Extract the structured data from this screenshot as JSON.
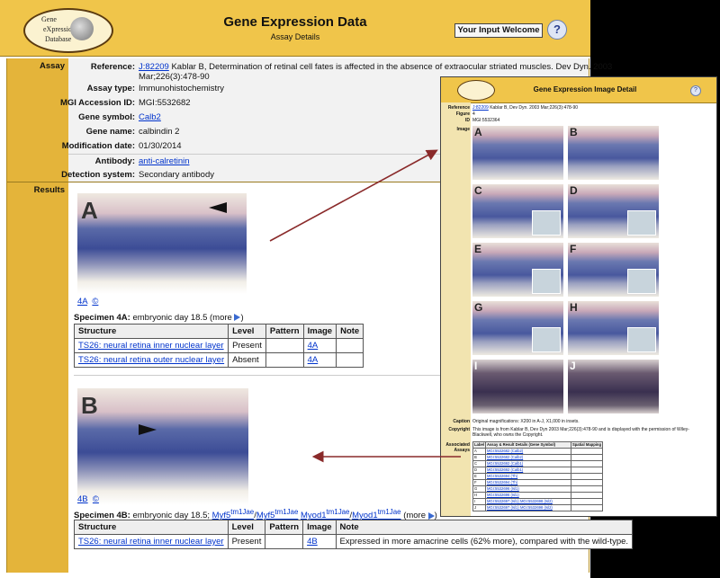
{
  "header": {
    "title": "Gene Expression Data",
    "subtitle": "Assay Details",
    "welcome": "Your Input Welcome",
    "help": "?",
    "logo_lines": [
      "Gene",
      "eXpression",
      "Database"
    ]
  },
  "sections": {
    "assay": "Assay",
    "results": "Results"
  },
  "assay": {
    "reference_label": "Reference:",
    "reference_link": "J:82209",
    "reference_text": "Kablar B, Determination of retinal cell fates is affected in the absence of extraocular striated muscles. Dev Dyn. 2003",
    "reference_text2": "Mar;226(3):478-90",
    "assay_type_label": "Assay type:",
    "assay_type": "Immunohistochemistry",
    "mgi_label": "MGI Accession ID:",
    "mgi": "MGI:5532682",
    "symbol_label": "Gene symbol:",
    "symbol": "Calb2",
    "name_label": "Gene name:",
    "name": "calbindin 2",
    "mod_label": "Modification date:",
    "mod": "01/30/2014",
    "antibody_label": "Antibody:",
    "antibody": "anti-calretinin",
    "detection_label": "Detection system:",
    "detection": "Secondary antibody"
  },
  "specimen_a": {
    "letter": "A",
    "img_link": "4A",
    "copyright": "©",
    "title_bold": "Specimen 4A:",
    "desc": "embryonic day 18.5 (more",
    "headers": [
      "Structure",
      "Level",
      "Pattern",
      "Image",
      "Note"
    ],
    "rows": [
      {
        "structure": "TS26: neural retina inner nuclear layer",
        "level": "Present",
        "pattern": "",
        "image": "4A",
        "note": ""
      },
      {
        "structure": "TS26: neural retina outer nuclear layer",
        "level": "Absent",
        "pattern": "",
        "image": "4A",
        "note": ""
      }
    ]
  },
  "specimen_b": {
    "letter": "B",
    "img_link": "4B",
    "copyright": "©",
    "title_bold": "Specimen 4B:",
    "desc": "embryonic day 18.5;",
    "g1": "Myf5",
    "g1sup": "tm1Jae",
    "g2": "Myf5",
    "g2sup": "tm1Jae",
    "g3": "Myod1",
    "g3sup": "tm1Jae",
    "g4": "Myod1",
    "g4sup": "tm1Jae",
    "more": "(more",
    "headers": [
      "Structure",
      "Level",
      "Pattern",
      "Image",
      "Note"
    ],
    "row": {
      "structure": "TS26: neural retina inner nuclear layer",
      "level": "Present",
      "pattern": "",
      "image": "4B",
      "note": "Expressed in more amacrine cells (62% more), compared with the wild-type."
    }
  },
  "overlay": {
    "title": "Gene Expression Image Detail",
    "help": "?",
    "reference_label": "Reference",
    "reference_link": "J:82209",
    "reference_text": "Kablar B, Dev Dyn. 2003 Mar;226(3):478-90",
    "figure_label": "Figure",
    "figure": "4",
    "id_label": "ID",
    "id": "MGI:5532364",
    "image_label": "Image",
    "thumb_labels": [
      "A",
      "B",
      "C",
      "D",
      "E",
      "F",
      "G",
      "H",
      "I",
      "J"
    ],
    "caption_label": "Caption",
    "caption": "Original magnifications: X200 in A-J, X1,000 in insets.",
    "copyright_label": "Copyright",
    "copyright_1": "This image is from Kablar B, Dev Dyn 2003 Mar;226(3):478-90 and is displayed with the permission of Wiley-",
    "copyright_2": "Blackwell, who owns the Copyright.",
    "assoc_label_1": "Associated",
    "assoc_label_2": "Assays",
    "table_headers": [
      "Label",
      "Assay & Result Details (Gene Symbol)",
      "Spatial Mapping"
    ],
    "table_rows": [
      {
        "label": "A",
        "detail": "MGI:5532682 (Calb2)"
      },
      {
        "label": "B",
        "detail": "MGI:5532682 (Calb2)"
      },
      {
        "label": "C",
        "detail": "MGI:5532692 (Calb1)"
      },
      {
        "label": "D",
        "detail": "MGI:5532692 (Calb1)"
      },
      {
        "label": "E",
        "detail": "MGI:5532694 (Th)"
      },
      {
        "label": "F",
        "detail": "MGI:5532694 (Th)"
      },
      {
        "label": "G",
        "detail": "MGI:5532696 (Isl1)"
      },
      {
        "label": "H",
        "detail": "MGI:5532696 (Isl1)"
      },
      {
        "label": "I",
        "detail": "MGI:5532697 (Isl1) MGI:5532698 (Isl2)"
      },
      {
        "label": "J",
        "detail": "MGI:5532697 (Isl1) MGI:5532698 (Isl2)"
      }
    ]
  }
}
